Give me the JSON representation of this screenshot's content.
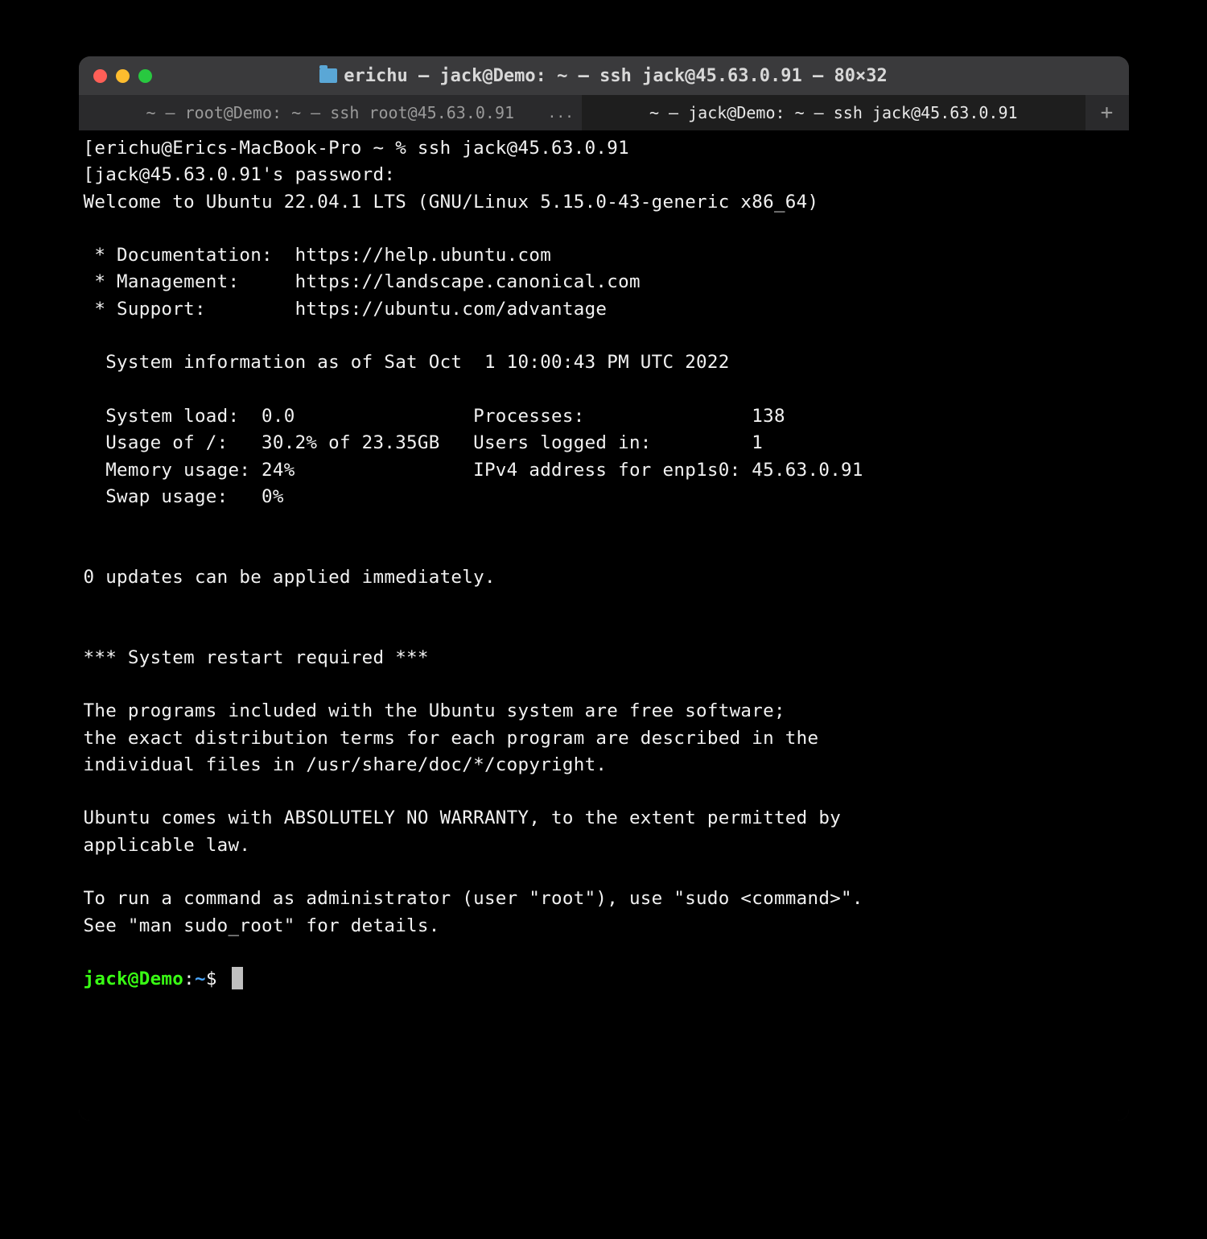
{
  "window": {
    "title": "erichu — jack@Demo: ~ — ssh jack@45.63.0.91 — 80×32"
  },
  "tabs": [
    {
      "label": "~ — root@Demo: ~ — ssh root@45.63.0.91",
      "active": false,
      "overflow": "..."
    },
    {
      "label": "~ — jack@Demo: ~ — ssh jack@45.63.0.91",
      "active": true
    }
  ],
  "newtab_label": "+",
  "terminal": {
    "line_prompt1": "[erichu@Erics-MacBook-Pro ~ % ssh jack@45.63.0.91",
    "line_password": "[jack@45.63.0.91's password:",
    "line_welcome": "Welcome to Ubuntu 22.04.1 LTS (GNU/Linux 5.15.0-43-generic x86_64)",
    "line_doc": " * Documentation:  https://help.ubuntu.com",
    "line_mgmt": " * Management:     https://landscape.canonical.com",
    "line_support": " * Support:        https://ubuntu.com/advantage",
    "line_sysinfo": "  System information as of Sat Oct  1 10:00:43 PM UTC 2022",
    "line_stat1": "  System load:  0.0                Processes:               138",
    "line_stat2": "  Usage of /:   30.2% of 23.35GB   Users logged in:         1",
    "line_stat3": "  Memory usage: 24%                IPv4 address for enp1s0: 45.63.0.91",
    "line_stat4": "  Swap usage:   0%",
    "line_updates": "0 updates can be applied immediately.",
    "line_restart": "*** System restart required ***",
    "line_free1": "The programs included with the Ubuntu system are free software;",
    "line_free2": "the exact distribution terms for each program are described in the",
    "line_free3": "individual files in /usr/share/doc/*/copyright.",
    "line_warr1": "Ubuntu comes with ABSOLUTELY NO WARRANTY, to the extent permitted by",
    "line_warr2": "applicable law.",
    "line_sudo1": "To run a command as administrator (user \"root\"), use \"sudo <command>\".",
    "line_sudo2": "See \"man sudo_root\" for details.",
    "prompt_user": "jack@Demo",
    "prompt_colon": ":",
    "prompt_path": "~",
    "prompt_dollar": "$"
  }
}
